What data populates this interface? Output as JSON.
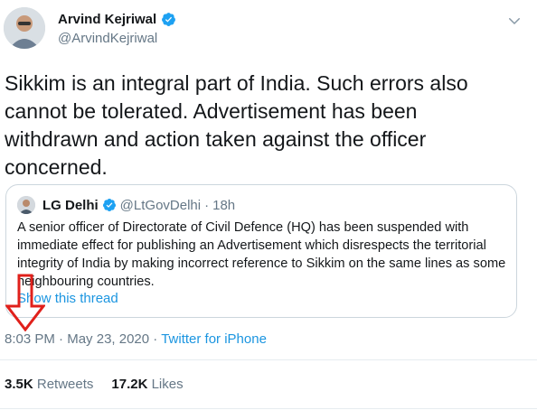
{
  "author": {
    "name": "Arvind Kejriwal",
    "handle": "@ArvindKejriwal",
    "verified": true
  },
  "tweet": {
    "text": "Sikkim is an integral part of India. Such errors also cannot be tolerated. Advertisement has been withdrawn and action taken against the officer concerned."
  },
  "quoted_tweet": {
    "name": "LG Delhi",
    "handle": "@LtGovDelhi",
    "separator": "·",
    "time": "18h",
    "text": "A senior officer of Directorate of Civil Defence (HQ) has been suspended with immediate effect for publishing an Advertisement which disrespects the territorial integrity of India by making incorrect reference to Sikkim on the same lines as some neighbouring countries.",
    "show_thread": "Show this thread"
  },
  "meta": {
    "time": "8:03 PM",
    "separator": "·",
    "date": "May 23, 2020",
    "source": "Twitter for iPhone"
  },
  "stats": {
    "retweets_count": "3.5K",
    "retweets_label": "Retweets",
    "likes_count": "17.2K",
    "likes_label": "Likes"
  },
  "colors": {
    "link": "#1b95e0",
    "secondary_text": "#657786",
    "annotation_arrow": "#e0201b"
  },
  "icons": [
    "verified-badge-icon",
    "chevron-down-icon",
    "red-down-arrow-annotation"
  ]
}
